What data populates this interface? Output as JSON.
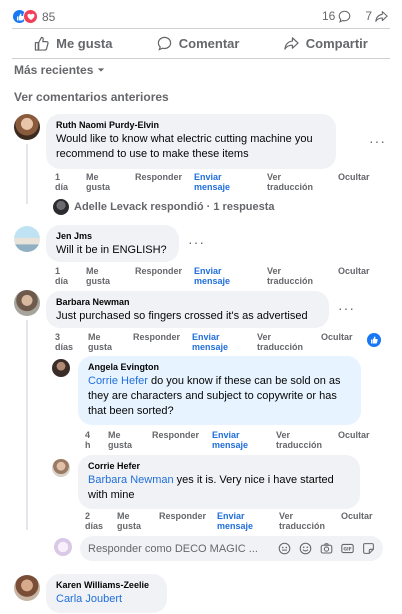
{
  "reactions": {
    "count": "85"
  },
  "stats": {
    "comments": "16",
    "shares": "7"
  },
  "actions": {
    "like": "Me gusta",
    "comment": "Comentar",
    "share": "Compartir"
  },
  "sort_label": "Más recientes",
  "previous_label": "Ver comentarios anteriores",
  "comments": [
    {
      "author": "Ruth Naomi Purdy-Elvin",
      "text": "Would like to know what electric cutting machine you recommend to use to make these items",
      "time": [
        "1",
        "día"
      ],
      "like": [
        "Me",
        "gusta"
      ],
      "reply": "Responder",
      "send": [
        "Enviar",
        "mensaje"
      ],
      "translate": [
        "Ver",
        "traducción"
      ],
      "hide": "Ocultar",
      "reply_summary": "Adelle Levack respondió · 1 respuesta"
    },
    {
      "author": "Jen Jms",
      "text": "Will it be in ENGLISH?",
      "time": [
        "1",
        "día"
      ],
      "like": [
        "Me",
        "gusta"
      ],
      "reply": "Responder",
      "send": [
        "Enviar",
        "mensaje"
      ],
      "translate": [
        "Ver",
        "traducción"
      ],
      "hide": "Ocultar"
    },
    {
      "author": "Barbara Newman",
      "text": "Just purchased so fingers crossed it's as advertised",
      "time": [
        "3",
        "días"
      ],
      "like": [
        "Me",
        "gusta"
      ],
      "reply": "Responder",
      "send": [
        "Enviar",
        "mensaje"
      ],
      "translate": [
        "Ver",
        "traducción"
      ],
      "hide": "Ocultar",
      "replies": [
        {
          "author": "Angela Evington",
          "mention": "Corrie Hefer",
          "text": " do you know if these can be sold on as they are characters and subject to copywrite or has that been sorted?",
          "time": [
            "4",
            "h"
          ],
          "like": [
            "Me",
            "gusta"
          ],
          "reply": "Responder",
          "send": [
            "Enviar",
            "mensaje"
          ],
          "translate": [
            "Ver",
            "traducción"
          ],
          "hide": "Ocultar"
        },
        {
          "author": "Corrie Hefer",
          "mention": "Barbara Newman",
          "text": " yes it is. Very nice i have started with mine",
          "time": [
            "2",
            "días"
          ],
          "like": [
            "Me",
            "gusta"
          ],
          "reply": "Responder",
          "send": [
            "Enviar",
            "mensaje"
          ],
          "translate": [
            "Ver",
            "traducción"
          ],
          "hide": "Ocultar"
        }
      ]
    },
    {
      "author": "Karen Williams-Zeelie",
      "mention": "Carla Joubert"
    }
  ],
  "compose": {
    "placeholder": "Responder como DECO MAGIC ..."
  },
  "colors": {
    "accent": "#1877f2",
    "love": "#f33e58",
    "mention": "#216fdb",
    "bubble": "#f0f2f5",
    "highlight": "#e7f3ff"
  }
}
